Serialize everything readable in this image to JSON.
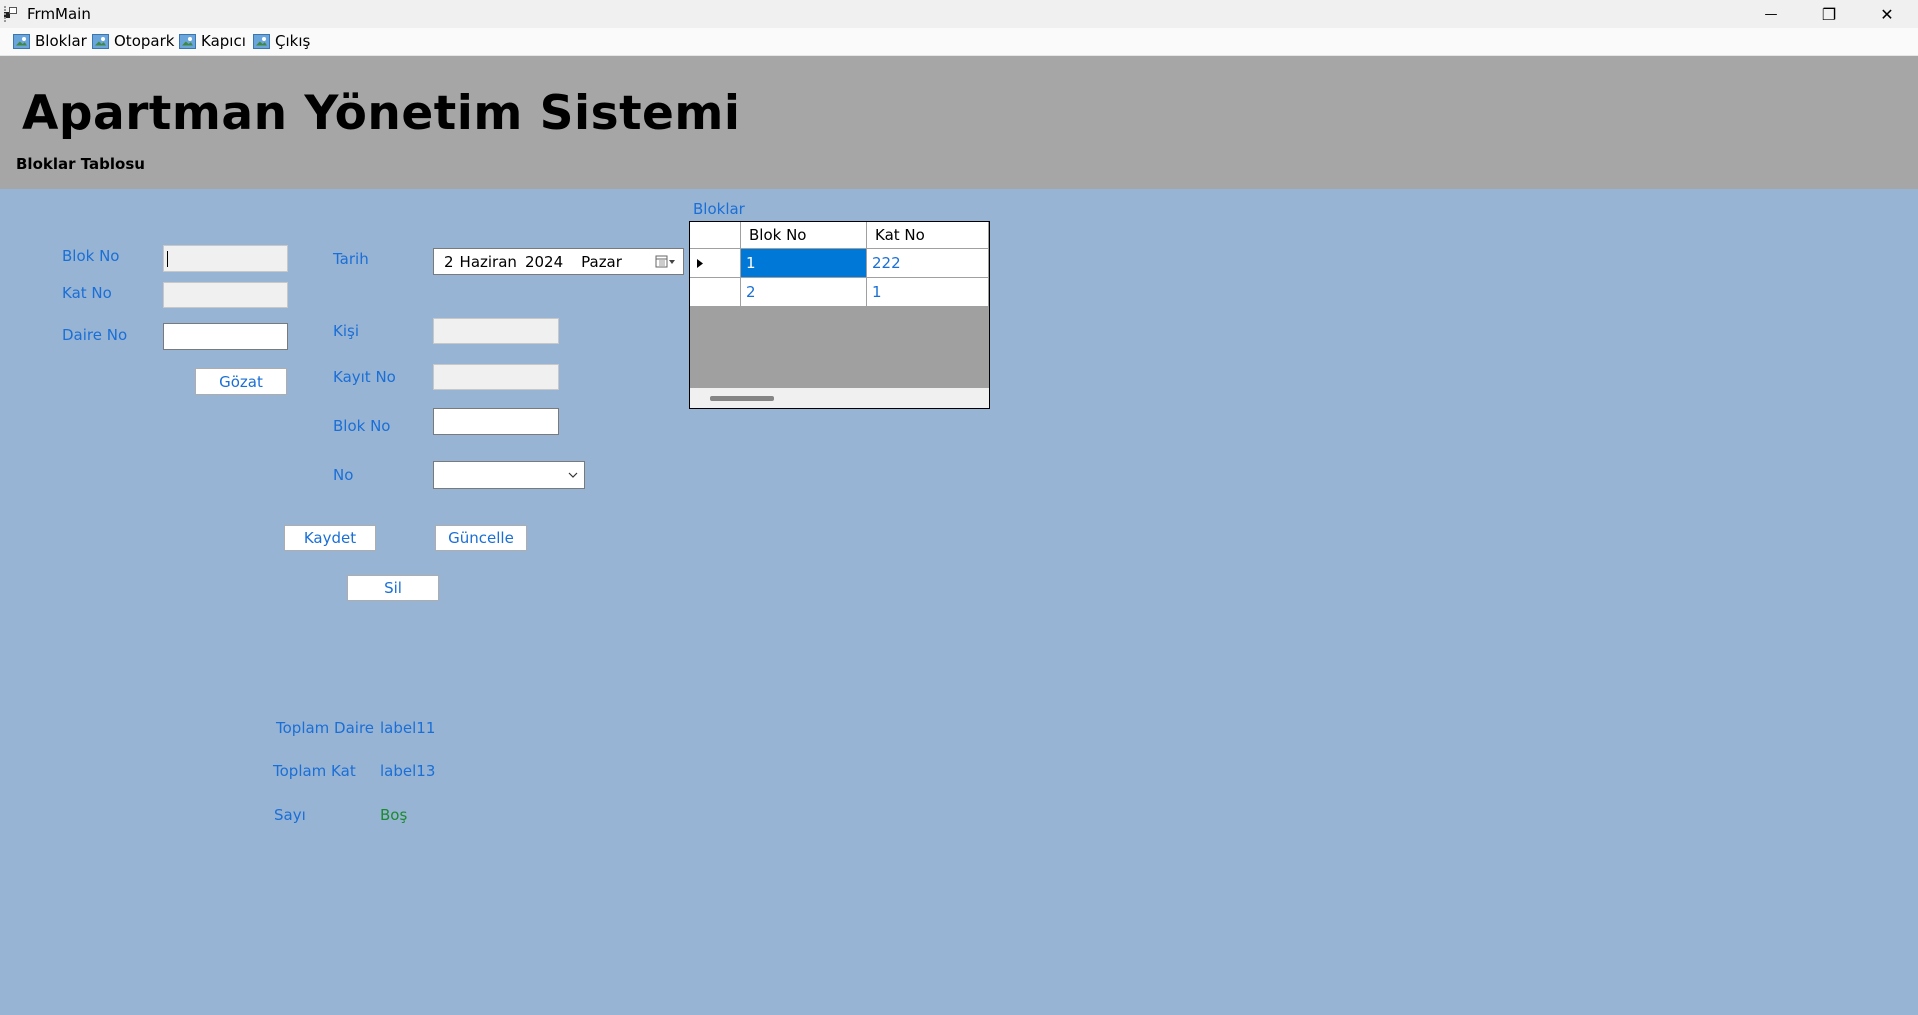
{
  "window": {
    "title": "FrmMain",
    "minimize_glyph": "—",
    "restore_glyph": "❐",
    "close_glyph": "✕"
  },
  "menu": {
    "items": [
      {
        "label": "Bloklar",
        "icon": "image-icon"
      },
      {
        "label": "Otopark",
        "icon": "image-icon"
      },
      {
        "label": "Kapıcı",
        "icon": "image-icon"
      },
      {
        "label": "Çıkış",
        "icon": "image-icon"
      }
    ]
  },
  "header": {
    "title": "Apartman Yönetim Sistemi",
    "subtitle": "Bloklar Tablosu"
  },
  "left_form": {
    "blok_no_label": "Blok No",
    "blok_no_value": "",
    "kat_no_label": "Kat No",
    "kat_no_value": "",
    "daire_no_label": "Daire No",
    "daire_no_value": "",
    "gozat_button": "Gözat"
  },
  "right_form": {
    "tarih_label": "Tarih",
    "date_day": "2",
    "date_month": "Haziran",
    "date_year": "2024",
    "date_weekday": "Pazar",
    "kisi_label": "Kişi",
    "kisi_value": "",
    "kayit_no_label": "Kayıt No",
    "kayit_no_value": "",
    "blok_no_label": "Blok No",
    "blok_no_value": "",
    "no_label": "No",
    "no_selected": ""
  },
  "actions": {
    "kaydet": "Kaydet",
    "guncelle": "Güncelle",
    "sil": "Sil"
  },
  "grid": {
    "caption": "Bloklar",
    "columns": [
      "Blok No",
      "Kat No"
    ],
    "rows": [
      {
        "blok_no": "1",
        "kat_no": "222",
        "selected": true
      },
      {
        "blok_no": "2",
        "kat_no": "1",
        "selected": false
      }
    ]
  },
  "stats": {
    "toplam_daire_label": "Toplam Daire",
    "toplam_daire_value": "label11",
    "toplam_kat_label": "Toplam Kat",
    "toplam_kat_value": "label13",
    "sayi_label": "Sayı",
    "sayi_value": "Boş"
  },
  "colors": {
    "form_background": "#98b4d4",
    "header_background": "#a6a6a6",
    "label_blue": "#1a6fd6",
    "status_green": "#1a8a2e",
    "selection": "#0078d7"
  }
}
